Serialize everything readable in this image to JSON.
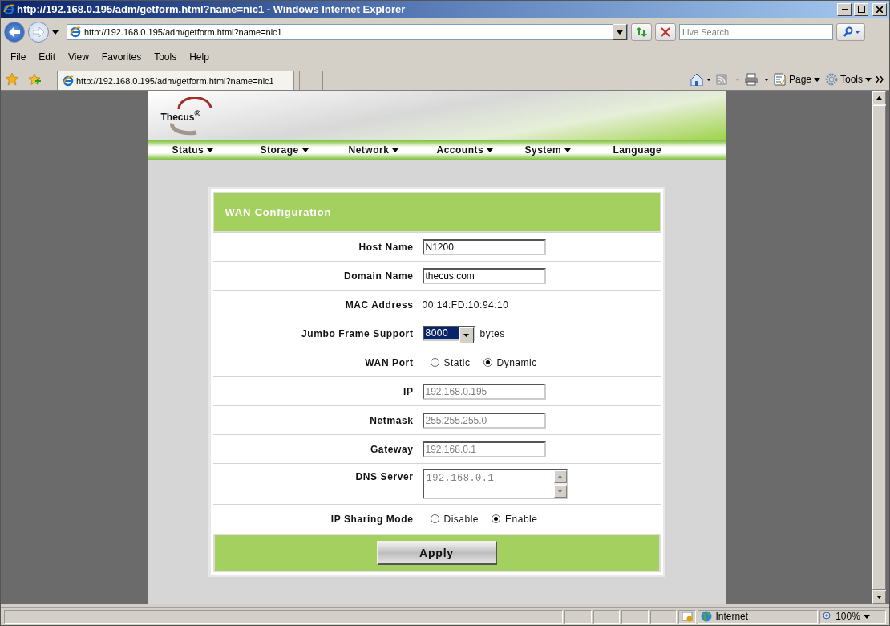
{
  "window": {
    "title": "http://192.168.0.195/adm/getform.html?name=nic1 - Windows Internet Explorer"
  },
  "address_bar": {
    "url": "http://192.168.0.195/adm/getform.html?name=nic1",
    "search_placeholder": "Live Search"
  },
  "menu": [
    "File",
    "Edit",
    "View",
    "Favorites",
    "Tools",
    "Help"
  ],
  "favorites_bar": {
    "tabs": [
      {
        "label": "http://192.168.0.195/adm/getform.html?name=nic1",
        "selected": true
      }
    ],
    "commands": [
      "Page",
      "Tools"
    ]
  },
  "page": {
    "logo": "Thecus$^{®}$",
    "nav": [
      {
        "label": "Status",
        "has_menu": true
      },
      {
        "label": "Storage",
        "has_menu": true
      },
      {
        "label": "Network",
        "has_menu": true
      },
      {
        "label": "Accounts",
        "has_menu": true
      },
      {
        "label": "System",
        "has_menu": true
      },
      {
        "label": "Language",
        "has_menu": false
      }
    ],
    "form": {
      "title": "WAN Configuration",
      "rows": [
        {
          "kind": "text",
          "label": "Host Name",
          "value": "N1200",
          "disabled": false
        },
        {
          "kind": "text",
          "label": "Domain Name",
          "value": "thecus.com",
          "disabled": false
        },
        {
          "kind": "static",
          "label": "MAC Address",
          "value": "00:14:FD:10:94:10"
        },
        {
          "kind": "select",
          "label": "Jumbo Frame Support",
          "value": "8000",
          "unit": "bytes"
        },
        {
          "kind": "radio",
          "label": "WAN Port",
          "options": [
            {
              "label": "Static",
              "selected": false
            },
            {
              "label": "Dynamic",
              "selected": true
            }
          ]
        },
        {
          "kind": "text",
          "label": "IP",
          "value": "192.168.0.195",
          "disabled": true
        },
        {
          "kind": "text",
          "label": "Netmask",
          "value": "255.255.255.0",
          "disabled": true
        },
        {
          "kind": "text",
          "label": "Gateway",
          "value": "192.168.0.1",
          "disabled": true
        },
        {
          "kind": "textarea",
          "label": "DNS Server",
          "value": "192.168.0.1",
          "disabled": true
        },
        {
          "kind": "radio",
          "label": "IP Sharing Mode",
          "options": [
            {
              "label": "Disable",
              "selected": false
            },
            {
              "label": "Enable",
              "selected": true
            }
          ]
        }
      ],
      "button": "Apply"
    }
  },
  "status_bar": {
    "zone": "Internet",
    "zoom": "100%"
  }
}
